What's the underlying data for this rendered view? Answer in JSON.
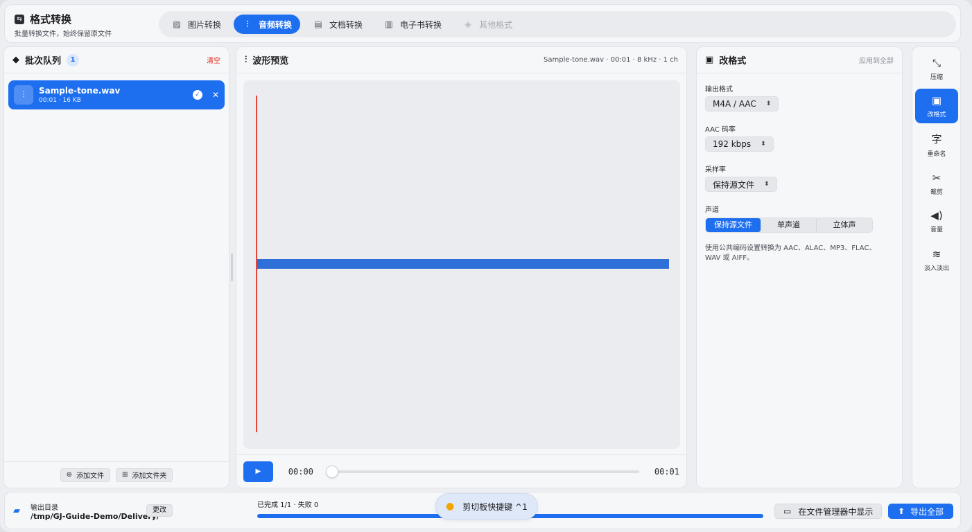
{
  "app": {
    "name": "格式转换",
    "subtitle": "批量转换文件，始终保留原文件"
  },
  "tabs": [
    {
      "label": "图片转换",
      "icon": "image-icon",
      "state": "normal"
    },
    {
      "label": "音频转换",
      "icon": "waveform-icon",
      "state": "active"
    },
    {
      "label": "文档转换",
      "icon": "document-icon",
      "state": "normal"
    },
    {
      "label": "电子书转换",
      "icon": "books-icon",
      "state": "normal"
    },
    {
      "label": "其他格式",
      "icon": "cube-icon",
      "state": "disabled"
    }
  ],
  "queue": {
    "title": "批次队列",
    "count": "1",
    "clear_label": "清空",
    "items": [
      {
        "name": "Sample-tone.wav",
        "meta": "00:01 · 16 KB",
        "status": "done"
      }
    ],
    "add_file_label": "添加文件",
    "add_folder_label": "添加文件夹"
  },
  "preview": {
    "title": "波形预览",
    "meta": "Sample-tone.wav · 00:01 · 8 kHz · 1 ch",
    "time_current": "00:00",
    "time_total": "00:01",
    "playback_progress": 0
  },
  "format": {
    "title": "改格式",
    "apply_all_label": "应用到全部",
    "output_format_label": "输出格式",
    "output_format_value": "M4A / AAC",
    "bitrate_label": "AAC 码率",
    "bitrate_value": "192 kbps",
    "samplerate_label": "采样率",
    "samplerate_value": "保持源文件",
    "channel_label": "声道",
    "channel_options": [
      "保持源文件",
      "单声道",
      "立体声"
    ],
    "channel_selected": "保持源文件",
    "hint": "使用公共编码设置转换为 AAC、ALAC、MP3、FLAC、WAV 或 AIFF。"
  },
  "tools": [
    {
      "label": "压缩",
      "icon": "compress-icon",
      "glyph": "⤡"
    },
    {
      "label": "改格式",
      "icon": "format-icon",
      "glyph": "▣",
      "active": true
    },
    {
      "label": "重命名",
      "icon": "rename-icon",
      "glyph": "字"
    },
    {
      "label": "裁剪",
      "icon": "scissors-icon",
      "glyph": "✂"
    },
    {
      "label": "音量",
      "icon": "speaker-icon",
      "glyph": "🔊"
    },
    {
      "label": "淡入淡出",
      "icon": "fade-icon",
      "glyph": "≋"
    }
  ],
  "status": {
    "output_label": "输出目录",
    "output_path": "/tmp/GJ-Guide-Demo/Delivery/",
    "change_label": "更改",
    "progress_text": "已完成 1/1 · 失败 0",
    "progress": 1.0,
    "reveal_label": "在文件管理器中显示",
    "export_label": "导出全部"
  },
  "toast": {
    "text": "剪切板快捷键 ^1"
  },
  "colors": {
    "accent": "#1e6ff0",
    "danger": "#e0301e",
    "playhead": "#e0473c"
  }
}
